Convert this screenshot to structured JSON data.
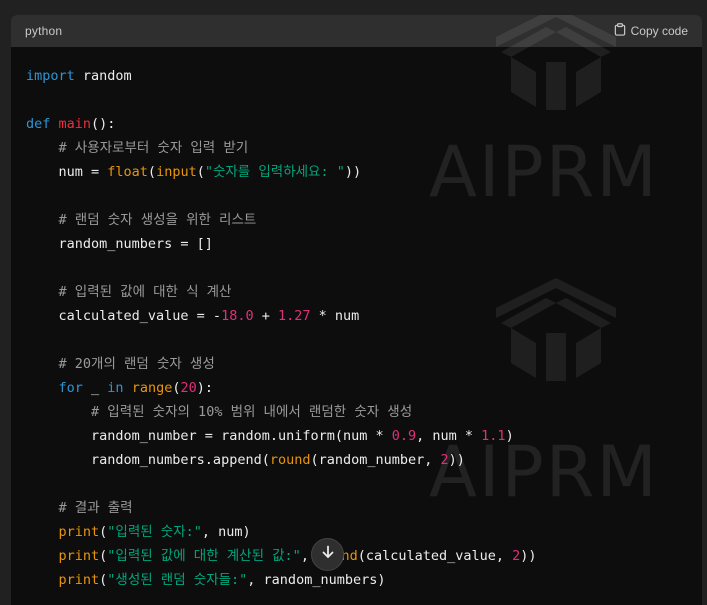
{
  "code_block": {
    "language_label": "python",
    "copy_label": "Copy code",
    "lines": [
      [
        {
          "t": "import",
          "c": "kw"
        },
        {
          "t": " random",
          "c": ""
        }
      ],
      [],
      [
        {
          "t": "def",
          "c": "kw"
        },
        {
          "t": " ",
          "c": ""
        },
        {
          "t": "main",
          "c": "fn"
        },
        {
          "t": "():",
          "c": ""
        }
      ],
      [
        {
          "t": "    ",
          "c": ""
        },
        {
          "t": "# 사용자로부터 숫자 입력 받기",
          "c": "cm"
        }
      ],
      [
        {
          "t": "    num = ",
          "c": ""
        },
        {
          "t": "float",
          "c": "builtin"
        },
        {
          "t": "(",
          "c": ""
        },
        {
          "t": "input",
          "c": "builtin"
        },
        {
          "t": "(",
          "c": ""
        },
        {
          "t": "\"숫자를 입력하세요: \"",
          "c": "str"
        },
        {
          "t": "))",
          "c": ""
        }
      ],
      [],
      [
        {
          "t": "    ",
          "c": ""
        },
        {
          "t": "# 랜덤 숫자 생성을 위한 리스트",
          "c": "cm"
        }
      ],
      [
        {
          "t": "    random_numbers = []",
          "c": ""
        }
      ],
      [],
      [
        {
          "t": "    ",
          "c": ""
        },
        {
          "t": "# 입력된 값에 대한 식 계산",
          "c": "cm"
        }
      ],
      [
        {
          "t": "    calculated_value = -",
          "c": ""
        },
        {
          "t": "18.0",
          "c": "num"
        },
        {
          "t": " + ",
          "c": ""
        },
        {
          "t": "1.27",
          "c": "num"
        },
        {
          "t": " * num",
          "c": ""
        }
      ],
      [],
      [
        {
          "t": "    ",
          "c": ""
        },
        {
          "t": "# 20개의 랜덤 숫자 생성",
          "c": "cm"
        }
      ],
      [
        {
          "t": "    ",
          "c": ""
        },
        {
          "t": "for",
          "c": "kw"
        },
        {
          "t": " _ ",
          "c": ""
        },
        {
          "t": "in",
          "c": "kw"
        },
        {
          "t": " ",
          "c": ""
        },
        {
          "t": "range",
          "c": "builtin"
        },
        {
          "t": "(",
          "c": ""
        },
        {
          "t": "20",
          "c": "num"
        },
        {
          "t": "):",
          "c": ""
        }
      ],
      [
        {
          "t": "        ",
          "c": ""
        },
        {
          "t": "# 입력된 숫자의 10% 범위 내에서 랜덤한 숫자 생성",
          "c": "cm"
        }
      ],
      [
        {
          "t": "        random_number = random.uniform(num * ",
          "c": ""
        },
        {
          "t": "0.9",
          "c": "num"
        },
        {
          "t": ", num * ",
          "c": ""
        },
        {
          "t": "1.1",
          "c": "num"
        },
        {
          "t": ")",
          "c": ""
        }
      ],
      [
        {
          "t": "        random_numbers.append(",
          "c": ""
        },
        {
          "t": "round",
          "c": "builtin"
        },
        {
          "t": "(random_number, ",
          "c": ""
        },
        {
          "t": "2",
          "c": "num"
        },
        {
          "t": "))",
          "c": ""
        }
      ],
      [],
      [
        {
          "t": "    ",
          "c": ""
        },
        {
          "t": "# 결과 출력",
          "c": "cm"
        }
      ],
      [
        {
          "t": "    ",
          "c": ""
        },
        {
          "t": "print",
          "c": "builtin"
        },
        {
          "t": "(",
          "c": ""
        },
        {
          "t": "\"입력된 숫자:\"",
          "c": "str"
        },
        {
          "t": ", num)",
          "c": ""
        }
      ],
      [
        {
          "t": "    ",
          "c": ""
        },
        {
          "t": "print",
          "c": "builtin"
        },
        {
          "t": "(",
          "c": ""
        },
        {
          "t": "\"입력된 값에 대한 계산된 값:\"",
          "c": "str"
        },
        {
          "t": ", ",
          "c": ""
        },
        {
          "t": "round",
          "c": "builtin"
        },
        {
          "t": "(calculated_value, ",
          "c": ""
        },
        {
          "t": "2",
          "c": "num"
        },
        {
          "t": "))",
          "c": ""
        }
      ],
      [
        {
          "t": "    ",
          "c": ""
        },
        {
          "t": "print",
          "c": "builtin"
        },
        {
          "t": "(",
          "c": ""
        },
        {
          "t": "\"생성된 랜덤 숫자들:\"",
          "c": "str"
        },
        {
          "t": ", random_numbers)",
          "c": ""
        }
      ]
    ]
  },
  "watermark": {
    "text": "AIPRM",
    "color": "#ffffff"
  },
  "colors": {
    "keyword": "#2e95d3",
    "function": "#f22c3d",
    "string": "#00a67d",
    "number": "#df3079",
    "comment": "#9a9a9a",
    "builtin": "#e9950c"
  },
  "icons": {
    "copy": "clipboard-icon",
    "scroll": "arrow-down-icon"
  }
}
